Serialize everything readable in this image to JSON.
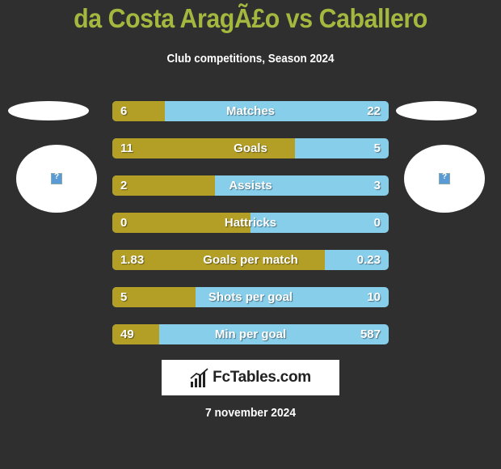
{
  "header": {
    "title": "da Costa AragÃ£o vs Caballero",
    "subtitle": "Club competitions, Season 2024"
  },
  "colors": {
    "background": "#2f2f2f",
    "title": "#a4b73e",
    "left_bar": "#b39f26",
    "right_bar": "#87ceeb"
  },
  "left_team": {
    "logo_icon": "broken-image-icon"
  },
  "right_team": {
    "logo_icon": "broken-image-icon"
  },
  "stats": [
    {
      "label": "Matches",
      "left": "6",
      "right": "22",
      "left_share": 0.19
    },
    {
      "label": "Goals",
      "left": "11",
      "right": "5",
      "left_share": 0.66
    },
    {
      "label": "Assists",
      "left": "2",
      "right": "3",
      "left_share": 0.37
    },
    {
      "label": "Hattricks",
      "left": "0",
      "right": "0",
      "left_share": 0.5
    },
    {
      "label": "Goals per match",
      "left": "1.83",
      "right": "0.23",
      "left_share": 0.77
    },
    {
      "label": "Shots per goal",
      "left": "5",
      "right": "10",
      "left_share": 0.3
    },
    {
      "label": "Min per goal",
      "left": "49",
      "right": "587",
      "left_share": 0.17
    }
  ],
  "footer": {
    "brand": "FcTables.com",
    "brand_icon": "bar-chart-icon",
    "date": "7 november 2024"
  }
}
